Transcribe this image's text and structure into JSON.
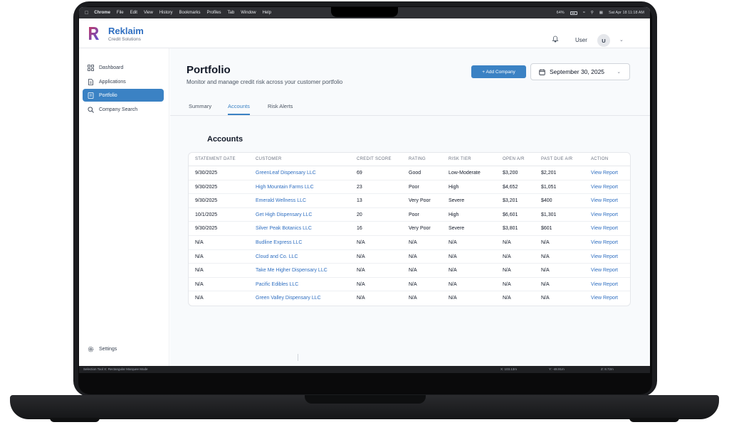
{
  "menubar": {
    "app": "Chrome",
    "items": [
      "File",
      "Edit",
      "View",
      "History",
      "Bookmarks",
      "Profiles",
      "Tab",
      "Window",
      "Help"
    ],
    "battery": "64%",
    "datetime": "Sat Apr 18  11:18 AM"
  },
  "brand": {
    "name": "Reklaim",
    "subtitle": "Credit Solutions"
  },
  "user": {
    "name": "User",
    "initial": "U"
  },
  "sidebar": {
    "items": [
      {
        "label": "Dashboard",
        "icon": "grid-icon"
      },
      {
        "label": "Applications",
        "icon": "document-icon"
      },
      {
        "label": "Portfolio",
        "icon": "portfolio-icon",
        "active": true
      },
      {
        "label": "Company Search",
        "icon": "search-icon"
      }
    ],
    "settings": "Settings"
  },
  "page": {
    "title": "Portfolio",
    "subtitle": "Monitor and manage credit risk across your customer portfolio",
    "add_button": "+ Add Company",
    "date": "September 30, 2025"
  },
  "tabs": [
    "Summary",
    "Accounts",
    "Risk Alerts"
  ],
  "active_tab": "Accounts",
  "section_title": "Accounts",
  "table": {
    "columns": [
      "STATEMENT DATE",
      "CUSTOMER",
      "CREDIT SCORE",
      "RATING",
      "RISK TIER",
      "OPEN A/R",
      "PAST DUE A/R",
      "ACTION"
    ],
    "rows": [
      [
        "9/30/2025",
        "GreenLeaf Dispensary LLC",
        "69",
        "Good",
        "Low-Moderate",
        "$3,200",
        "$2,201",
        "View Report"
      ],
      [
        "9/30/2025",
        "High Mountain Farms LLC",
        "23",
        "Poor",
        "High",
        "$4,652",
        "$1,051",
        "View Report"
      ],
      [
        "9/30/2025",
        "Emerald Wellness LLC",
        "13",
        "Very Poor",
        "Severe",
        "$3,201",
        "$400",
        "View Report"
      ],
      [
        "10/1/2025",
        "Get High Dispensary LLC",
        "20",
        "Poor",
        "High",
        "$6,601",
        "$1,301",
        "View Report"
      ],
      [
        "9/30/2025",
        "Silver Peak Botanics LLC",
        "16",
        "Very Poor",
        "Severe",
        "$3,801",
        "$601",
        "View Report"
      ],
      [
        "N/A",
        "Budline Express LLC",
        "N/A",
        "N/A",
        "N/A",
        "N/A",
        "N/A",
        "View Report"
      ],
      [
        "N/A",
        "Cloud and Co. LLC",
        "N/A",
        "N/A",
        "N/A",
        "N/A",
        "N/A",
        "View Report"
      ],
      [
        "N/A",
        "Take Me Higher Dispensary LLC",
        "N/A",
        "N/A",
        "N/A",
        "N/A",
        "N/A",
        "View Report"
      ],
      [
        "N/A",
        "Pacific Edibles LLC",
        "N/A",
        "N/A",
        "N/A",
        "N/A",
        "N/A",
        "View Report"
      ],
      [
        "N/A",
        "Green Valley Dispensary LLC",
        "N/A",
        "N/A",
        "N/A",
        "N/A",
        "N/A",
        "View Report"
      ]
    ]
  },
  "statusbar": {
    "left": "Selection Tool  X:  Rectangular Marquee Mode",
    "x": "X: 103.13m",
    "y": "Y: -48.91m",
    "z": "Z: 8.72m"
  },
  "colors": {
    "accent": "#3b82c4",
    "link": "#2f6fc1",
    "logo_gradient_start": "#c03b6b",
    "logo_gradient_end": "#5b4fcf"
  }
}
